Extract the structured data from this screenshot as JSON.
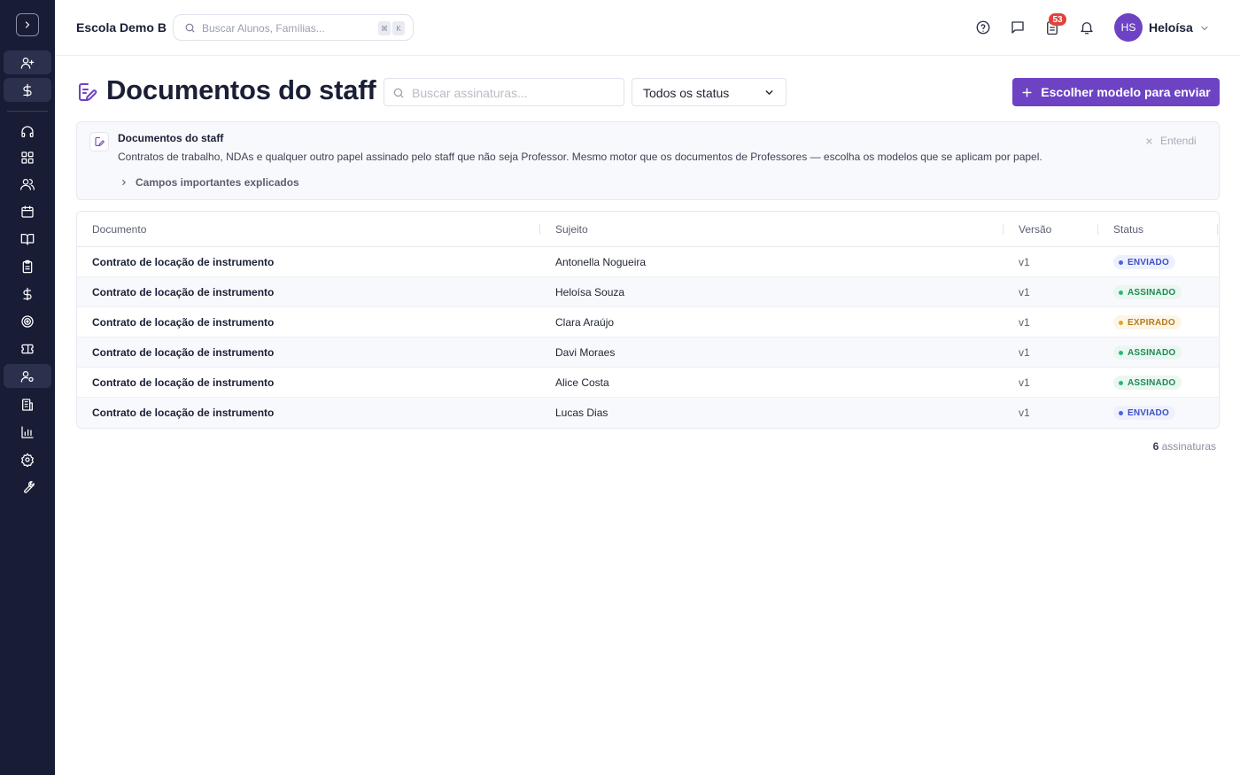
{
  "header": {
    "school_name": "Escola Demo B",
    "search_placeholder": "Buscar Alunos, Famílias...",
    "shortcut_keys": [
      "⌘",
      "K"
    ],
    "notification_count": "53",
    "user_initials": "HS",
    "user_name": "Heloísa"
  },
  "sidebar": {
    "items": [
      {
        "icon": "user-plus-icon"
      },
      {
        "icon": "dollar-icon"
      },
      {
        "icon": "headset-icon"
      },
      {
        "icon": "grid-icon"
      },
      {
        "icon": "users-icon"
      },
      {
        "icon": "calendar-icon"
      },
      {
        "icon": "book-open-icon"
      },
      {
        "icon": "clipboard-icon"
      },
      {
        "icon": "dollar-icon"
      },
      {
        "icon": "target-icon"
      },
      {
        "icon": "ticket-icon"
      },
      {
        "icon": "user-cog-icon",
        "active": true
      },
      {
        "icon": "building-icon"
      },
      {
        "icon": "bar-chart-icon"
      },
      {
        "icon": "settings-icon"
      },
      {
        "icon": "wrench-icon"
      }
    ]
  },
  "page": {
    "title": "Documentos do staff",
    "search_placeholder": "Buscar assinaturas...",
    "status_filter": "Todos os status",
    "primary_button": "Escolher modelo para enviar"
  },
  "info": {
    "title": "Documentos do staff",
    "description": "Contratos de trabalho, NDAs e qualquer outro papel assinado pelo staff que não seja Professor. Mesmo motor que os documentos de Professores — escolha os modelos que se aplicam por papel.",
    "expand_label": "Campos importantes explicados",
    "dismiss_label": "Entendi"
  },
  "table": {
    "columns": [
      "Documento",
      "Sujeito",
      "Versão",
      "Status"
    ],
    "rows": [
      {
        "document": "Contrato de locação de instrumento",
        "subject": "Antonella Nogueira",
        "version": "v1",
        "status": "ENVIADO"
      },
      {
        "document": "Contrato de locação de instrumento",
        "subject": "Heloísa Souza",
        "version": "v1",
        "status": "ASSINADO"
      },
      {
        "document": "Contrato de locação de instrumento",
        "subject": "Clara Araújo",
        "version": "v1",
        "status": "EXPIRADO"
      },
      {
        "document": "Contrato de locação de instrumento",
        "subject": "Davi Moraes",
        "version": "v1",
        "status": "ASSINADO"
      },
      {
        "document": "Contrato de locação de instrumento",
        "subject": "Alice Costa",
        "version": "v1",
        "status": "ASSINADO"
      },
      {
        "document": "Contrato de locação de instrumento",
        "subject": "Lucas Dias",
        "version": "v1",
        "status": "ENVIADO"
      }
    ],
    "status_colors": {
      "ENVIADO": {
        "text": "#3b4fc4",
        "bg": "#eef1fd",
        "dot": "#4d63d9"
      },
      "ASSINADO": {
        "text": "#1f8a55",
        "bg": "#eaf7f0",
        "dot": "#2eb872"
      },
      "EXPIRADO": {
        "text": "#b7791f",
        "bg": "#fdf6e7",
        "dot": "#e0a52a"
      }
    }
  },
  "footer": {
    "count": "6",
    "count_label": "assinaturas"
  },
  "colors": {
    "accent": "#6d43c4",
    "sidebar_bg": "#181c35",
    "badge": "#e0433c"
  }
}
